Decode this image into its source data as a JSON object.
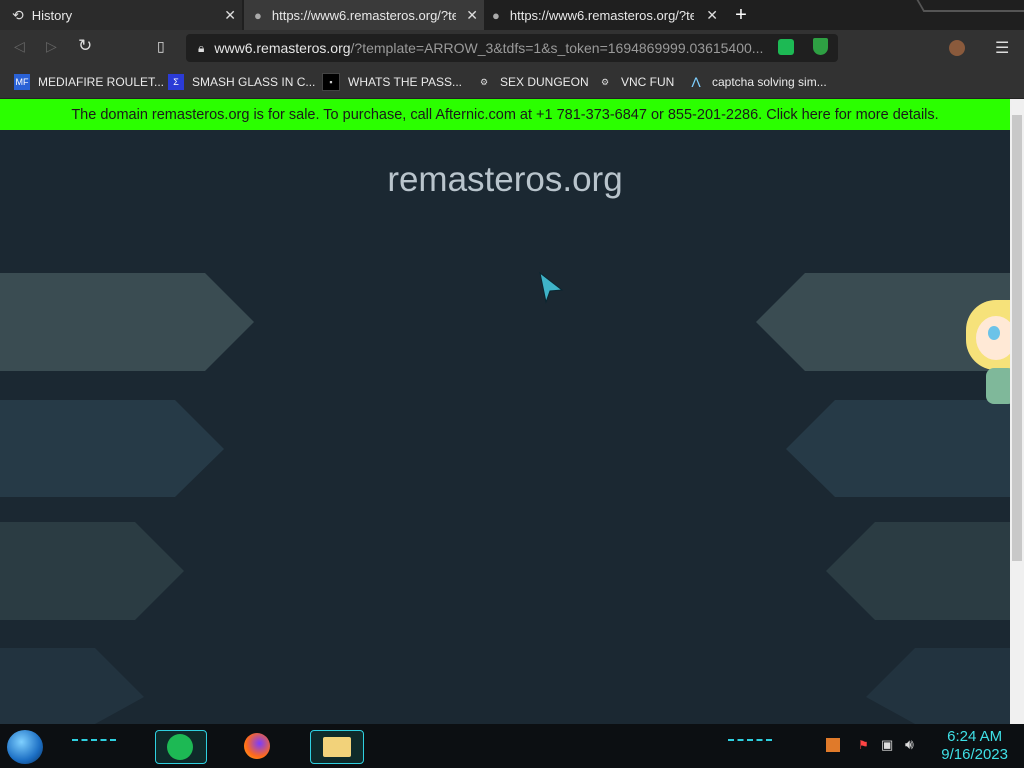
{
  "tabs": [
    {
      "title": "History",
      "icon": "history-icon"
    },
    {
      "title": "https://www6.remasteros.org/?tem",
      "icon": "globe-icon"
    },
    {
      "title": "https://www6.remasteros.org/?tem",
      "icon": "globe-icon"
    }
  ],
  "address": {
    "domain": "www6.remasteros.org",
    "rest": "/?template=ARROW_3&tdfs=1&s_token=1694869999.03615400..."
  },
  "bookmarks": [
    {
      "label": "MEDIAFIRE ROULET...",
      "icon": "mediafire-icon"
    },
    {
      "label": "SMASH GLASS IN C...",
      "icon": "glass-icon"
    },
    {
      "label": "WHATS THE PASS...",
      "icon": "terminal-icon"
    },
    {
      "label": "SEX DUNGEON",
      "icon": "badge-icon"
    },
    {
      "label": "VNC FUN",
      "icon": "badge-icon"
    },
    {
      "label": "captcha solving sim...",
      "icon": "lambda-icon"
    }
  ],
  "banner": {
    "text": "The domain remasteros.org is for sale. To purchase, call Afternic.com at +1 781-373-6847 or 855-201-2286. Click here for more details."
  },
  "page": {
    "title": "remasteros.org"
  },
  "clock": {
    "time": "6:24 AM",
    "date": "9/16/2023"
  },
  "colors": {
    "banner": "#2bff00",
    "page_bg": "#1b2832",
    "clock": "#3fe0e6"
  }
}
